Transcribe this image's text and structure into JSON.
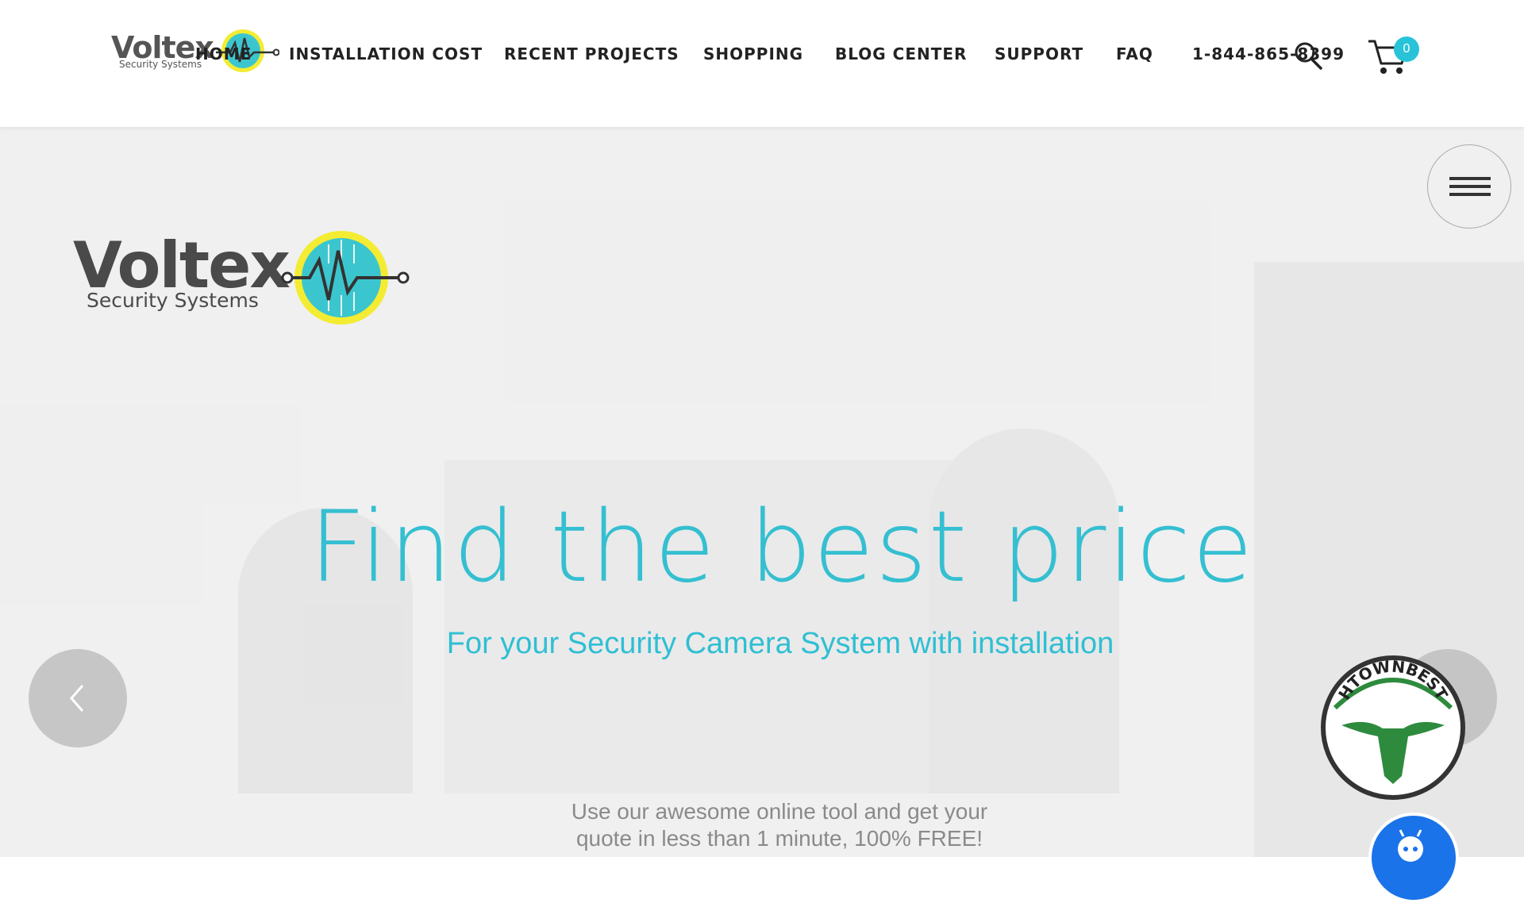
{
  "header": {
    "brand": {
      "word": "Voltex",
      "tagline": "Security Systems"
    },
    "nav": [
      {
        "label": "HOME"
      },
      {
        "label": "INSTALLATION COST"
      },
      {
        "label": "RECENT PROJECTS"
      },
      {
        "label": "SHOPPING"
      },
      {
        "label": "BLOG CENTER"
      },
      {
        "label": "SUPPORT"
      },
      {
        "label": "FAQ"
      },
      {
        "label": "1-844-865-8399"
      }
    ],
    "search_icon": "search-icon",
    "cart_icon": "cart-icon",
    "cart_count": "0"
  },
  "hero": {
    "brand": {
      "word": "Voltex",
      "tagline": "Security Systems"
    },
    "title": "Find the best price",
    "subtitle": "For your Security Camera System with installation",
    "description_line1": "Use our awesome online tool and get your",
    "description_line2": "quote in less than 1 minute, 100% FREE!",
    "menu_icon": "hamburger-icon",
    "prev_icon": "chevron-left-icon",
    "next_icon": "chevron-right-icon"
  },
  "badge": {
    "text": "HTOWNBEST"
  },
  "colors": {
    "accent": "#35bfd1",
    "badge_green": "#2e8b3e",
    "chat_blue": "#1a73e8"
  }
}
